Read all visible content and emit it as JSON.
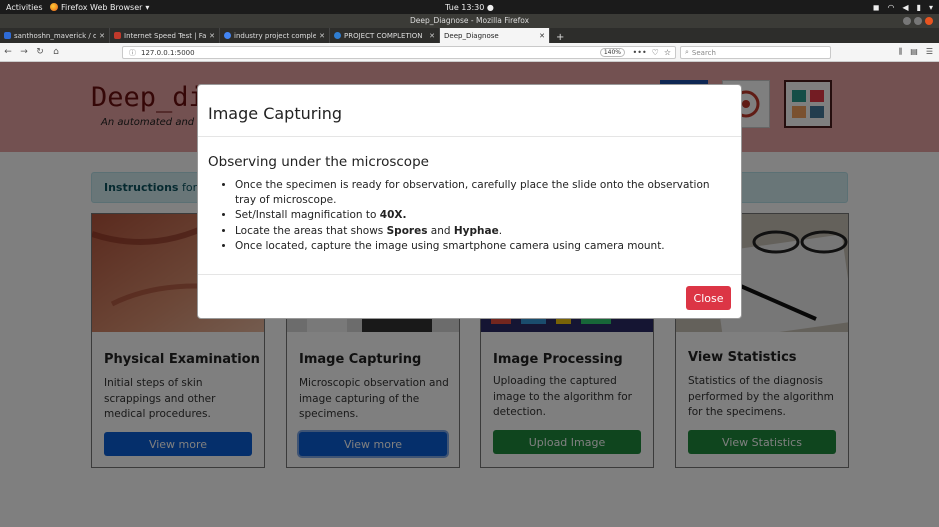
{
  "system_bar": {
    "activities": "Activities",
    "app_name": "Firefox Web Browser",
    "clock": "Tue 13:30"
  },
  "window": {
    "title": "Deep_Diagnose - Mozilla Firefox"
  },
  "tabs": [
    {
      "label": "santhoshn_maverick / d",
      "favicon_color": "#2e6bd6"
    },
    {
      "label": "Internet Speed Test | Fa",
      "favicon_color": "#c0392b"
    },
    {
      "label": "industry project comple",
      "favicon_color": "#4285f4"
    },
    {
      "label": "PROJECT COMPLETION",
      "favicon_color": "#2f7dd1"
    },
    {
      "label": "Deep_Diagnose",
      "favicon_color": "#ffffff"
    }
  ],
  "navbar": {
    "url": "127.0.0.1:5000",
    "zoom": "140%",
    "search_placeholder": "Search"
  },
  "page": {
    "brand": "Deep_di",
    "tagline": "An automated and",
    "instructions_bold": "Instructions",
    "instructions_rest": " for w"
  },
  "cards": [
    {
      "title": "Physical Examination",
      "text": "Initial steps of skin scrappings and other medical procedures.",
      "button": "View more"
    },
    {
      "title": "Image Capturing",
      "text": "Microscopic observation and image capturing of the specimens.",
      "button": "View more"
    },
    {
      "title": "Image Processing",
      "text": "Uploading the captured image to the algorithm for detection.",
      "button": "Upload Image"
    },
    {
      "title": "View Statistics",
      "text": "Statistics of the diagnosis performed by the algorithm for the specimens.",
      "button": "View Statistics"
    }
  ],
  "modal": {
    "title": "Image Capturing",
    "subtitle": "Observing under the microscope",
    "step1": "Once the specimen is ready for observation, carefully place the slide onto the observation tray of microscope.",
    "step2_prefix": "Set/Install magnification to ",
    "step2_bold": "40X.",
    "step3_prefix": "Locate the areas that shows ",
    "step3_bold1": "Spores",
    "step3_mid": " and ",
    "step3_bold2": "Hyphae",
    "step3_suffix": ".",
    "step4": "Once located, capture the image using smartphone camera using camera mount.",
    "close_button": "Close"
  },
  "colors": {
    "hero_bg": "#e7a2a2",
    "brand_color": "#6a0f0f",
    "primary": "#0b5fd6",
    "success": "#1e8a3c",
    "danger": "#dc3545"
  }
}
